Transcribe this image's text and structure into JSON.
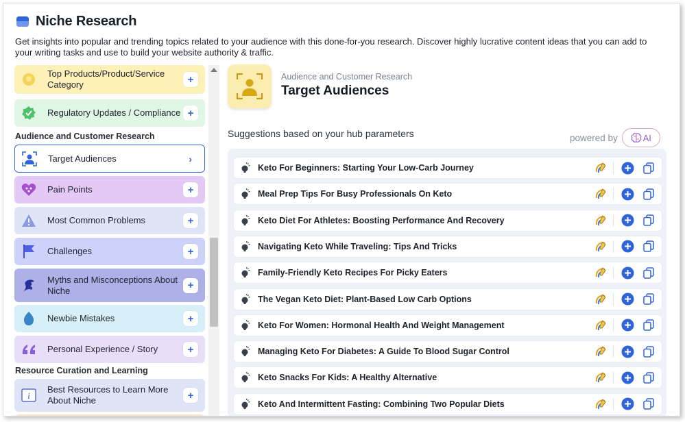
{
  "page": {
    "title": "Niche Research",
    "intro": "Get insights into popular and trending topics related to your audience with this done-for-you research. Discover highly lucrative content ideas that you can add to your writing tasks and use to build your website authority & traffic."
  },
  "sidebar": {
    "items_top": [
      {
        "label": "Top Products/Product/Service Category",
        "bg": "#fdf1b8",
        "icon": "lightbulb-icon"
      },
      {
        "label": "Regulatory Updates / Compliance",
        "bg": "#e1f7e6",
        "icon": "badge-check-icon"
      }
    ],
    "section_audience": "Audience and Customer Research",
    "items_audience": [
      {
        "label": "Target Audiences",
        "bg": "#ffffff",
        "icon": "user-focus-icon",
        "active": true
      },
      {
        "label": "Pain Points",
        "bg": "#e4c8f5",
        "icon": "heart-pain-icon"
      },
      {
        "label": "Most Common Problems",
        "bg": "#dfe4f7",
        "icon": "warning-icon"
      },
      {
        "label": "Challenges",
        "bg": "#cdd2fa",
        "icon": "flag-icon"
      },
      {
        "label": "Myths and Misconceptions About Niche",
        "bg": "#aeb0e8",
        "icon": "dragon-icon"
      },
      {
        "label": "Newbie Mistakes",
        "bg": "#d6eff9",
        "icon": "egg-icon"
      },
      {
        "label": "Personal Experience / Story",
        "bg": "#e8def8",
        "icon": "quote-icon"
      }
    ],
    "section_resources": "Resource Curation and Learning",
    "items_resources": [
      {
        "label": "Best Resources to Learn More About Niche",
        "bg": "#dfe4f7",
        "icon": "info-icon"
      }
    ],
    "plus": "+",
    "chevron": "›"
  },
  "main": {
    "hero_subtitle": "Audience and Customer Research",
    "hero_title": "Target Audiences",
    "suggestions_heading": "Suggestions based on your hub parameters",
    "powered_by": "powered by",
    "ai_label": "AI",
    "suggestions": [
      "Keto For Beginners: Starting Your Low-Carb Journey",
      "Meal Prep Tips For Busy Professionals On Keto",
      "Keto Diet For Athletes: Boosting Performance And Recovery",
      "Navigating Keto While Traveling: Tips And Tricks",
      "Family-Friendly Keto Recipes For Picky Eaters",
      "The Vegan Keto Diet: Plant-Based Low Carb Options",
      "Keto For Women: Hormonal Health And Weight Management",
      "Managing Keto For Diabetes: A Guide To Blood Sugar Control",
      "Keto Snacks For Kids: A Healthy Alternative",
      "Keto And Intermittent Fasting: Combining Two Popular Diets"
    ]
  },
  "colors": {
    "accent": "#2f63d9",
    "hero_bg": "#fbedb0",
    "list_bg": "#eef1f7"
  }
}
